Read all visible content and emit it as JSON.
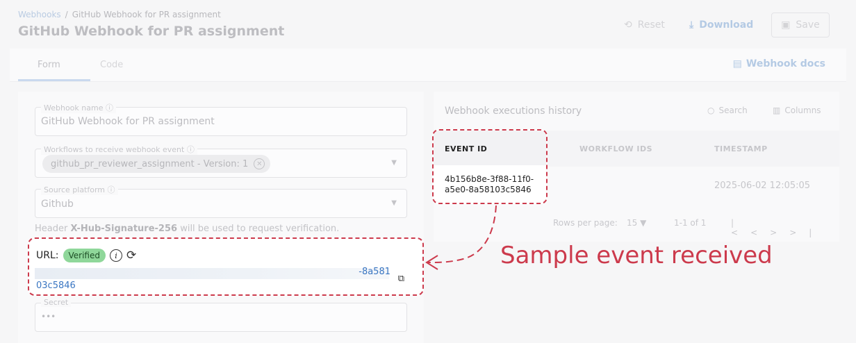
{
  "breadcrumb": {
    "root": "Webhooks",
    "separator": "/",
    "current": "GitHub Webhook for PR assignment"
  },
  "page_title": "GitHub Webhook for PR assignment",
  "header_actions": {
    "reset": "Reset",
    "download": "Download",
    "save": "Save"
  },
  "tabs": [
    {
      "label": "Form",
      "active": true
    },
    {
      "label": "Code",
      "active": false
    }
  ],
  "docs_link": "Webhook docs",
  "form": {
    "name": {
      "legend": "Webhook name",
      "value": "GitHub Webhook for PR assignment"
    },
    "workflows": {
      "legend": "Workflows to receive webhook event",
      "chip": "github_pr_reviewer_assignment - Version: 1"
    },
    "source": {
      "legend": "Source platform",
      "value": "Github"
    },
    "header_note": {
      "prefix": "Header",
      "header_name": "X-Hub-Signature-256",
      "suffix": "will be used to request verification."
    },
    "url": {
      "label": "URL:",
      "status": "Verified",
      "value_tail": "-8a581",
      "value_line2": "03c5846"
    },
    "secret": {
      "legend": "Secret",
      "value": "•••"
    }
  },
  "history": {
    "title": "Webhook executions history",
    "search": "Search",
    "columns": "Columns",
    "headers": [
      "EVENT ID",
      "WORKFLOW IDS",
      "TIMESTAMP"
    ],
    "rows": [
      {
        "event_id": "4b156b8e-3f88-11f0-a5e0-8a58103c5846",
        "workflow_ids": "",
        "timestamp": "2025-06-02 12:05:05"
      }
    ],
    "rows_per_page_label": "Rows per page:",
    "rows_per_page": "15",
    "range": "1-1 of 1"
  },
  "annotation": "Sample event received",
  "colors": {
    "annotation": "#cc3a4c",
    "verified_badge": "#8fd79a",
    "link": "#3a76c2"
  }
}
